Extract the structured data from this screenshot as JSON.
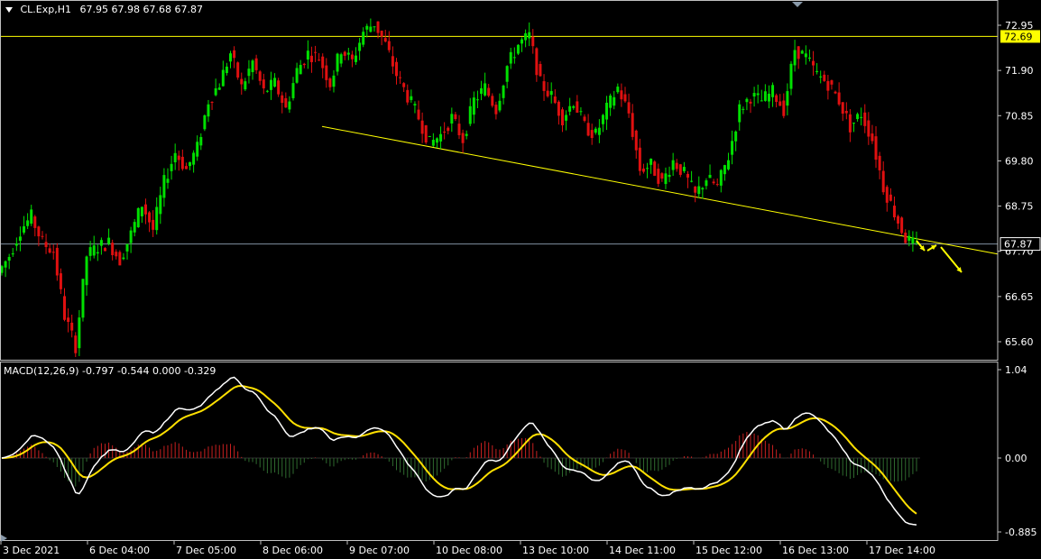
{
  "header": {
    "symbol": "CL.Exp,H1",
    "ohlc": "67.95 67.98 67.68 67.87"
  },
  "macd_panel": {
    "label": "MACD(12,26,9) -0.797 -0.544 0.000 -0.329"
  },
  "colors": {
    "background": "#000000",
    "bull": "#00e000",
    "bear": "#e01010",
    "line_yellow": "#ffff00",
    "macd_line": "#ffffff",
    "signal_line": "#ffe000",
    "hist_pos": "#c82020",
    "hist_neg": "#2f6b2f",
    "grid": "#c0c0c0",
    "current_price_line": "#8090a0"
  },
  "chart_data": [
    {
      "type": "candlestick",
      "title": "CL.Exp,H1",
      "ylim": [
        65.2,
        73.4
      ],
      "y_ticks": [
        72.95,
        71.9,
        70.85,
        69.8,
        68.75,
        67.7,
        66.65,
        65.6
      ],
      "x_ticks": [
        "3 Dec 2021",
        "6 Dec 04:00",
        "7 Dec 05:00",
        "8 Dec 06:00",
        "9 Dec 07:00",
        "10 Dec 08:00",
        "13 Dec 10:00",
        "14 Dec 11:00",
        "15 Dec 12:00",
        "16 Dec 13:00",
        "17 Dec 14:00"
      ],
      "horizontal_level": 72.69,
      "current_price": 67.87,
      "trendline": {
        "start_price": 70.6,
        "end_price": 67.7
      },
      "price_path": [
        67.2,
        67.6,
        68.2,
        68.5,
        67.9,
        67.7,
        66.2,
        65.5,
        67.6,
        67.8,
        67.9,
        67.5,
        68.1,
        68.8,
        68.2,
        69.3,
        70.0,
        69.6,
        70.1,
        71.2,
        71.6,
        72.3,
        71.5,
        72.1,
        71.4,
        71.6,
        71.0,
        71.9,
        72.3,
        72.2,
        71.6,
        72.4,
        72.1,
        72.8,
        73.0,
        72.5,
        71.8,
        71.3,
        70.8,
        70.2,
        70.4,
        70.8,
        70.3,
        71.2,
        71.5,
        71.0,
        72.0,
        72.5,
        72.7,
        71.6,
        71.3,
        70.8,
        71.2,
        70.6,
        70.4,
        71.0,
        71.5,
        70.9,
        69.6,
        69.7,
        69.3,
        69.8,
        69.5,
        69.0,
        69.4,
        69.2,
        69.9,
        71.0,
        71.3,
        71.2,
        71.4,
        71.0,
        72.4,
        72.2,
        71.8,
        71.6,
        71.2,
        70.6,
        70.9,
        70.3,
        69.2,
        68.6,
        68.0,
        67.8
      ]
    },
    {
      "type": "macd",
      "title": "MACD(12,26,9)",
      "ylim": [
        -0.885,
        1.04
      ],
      "y_ticks": [
        1.04,
        0.0,
        -0.885
      ],
      "values": {
        "macd": -0.797,
        "signal": -0.544,
        "zero": 0.0,
        "histogram": -0.329
      }
    }
  ]
}
